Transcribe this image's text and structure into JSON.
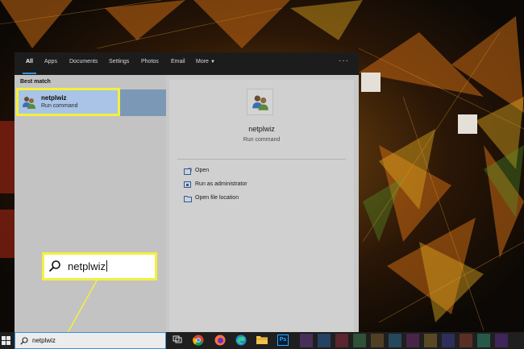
{
  "start_menu": {
    "tabs": [
      {
        "label": "All",
        "active": true
      },
      {
        "label": "Apps"
      },
      {
        "label": "Documents"
      },
      {
        "label": "Settings"
      },
      {
        "label": "Photos"
      },
      {
        "label": "Email"
      },
      {
        "label": "More"
      }
    ],
    "more_icon": "chevron-down-icon",
    "options_label": "···",
    "best_match_label": "Best match",
    "result": {
      "name": "netplwiz",
      "type": "Run command",
      "icon": "users-icon"
    },
    "detail": {
      "name": "netplwiz",
      "type": "Run command",
      "actions": [
        {
          "label": "Open",
          "icon": "open-icon"
        },
        {
          "label": "Run as administrator",
          "icon": "shield-icon"
        },
        {
          "label": "Open file location",
          "icon": "folder-icon"
        }
      ]
    }
  },
  "callout": {
    "text": "netplwiz",
    "icon": "search-icon"
  },
  "taskbar": {
    "search_text": "netplwiz",
    "icons": [
      "windows-icon",
      "search-icon",
      "task-view-icon",
      "chrome-icon",
      "firefox-icon",
      "edge-icon",
      "folder-icon",
      "photoshop-icon"
    ],
    "photoshop_label": "Ps"
  },
  "colors": {
    "highlight": "#f4f03c",
    "selection": "#a9c4e6",
    "accent": "#3a8fd8",
    "taskbar": "#1f1f1f"
  }
}
